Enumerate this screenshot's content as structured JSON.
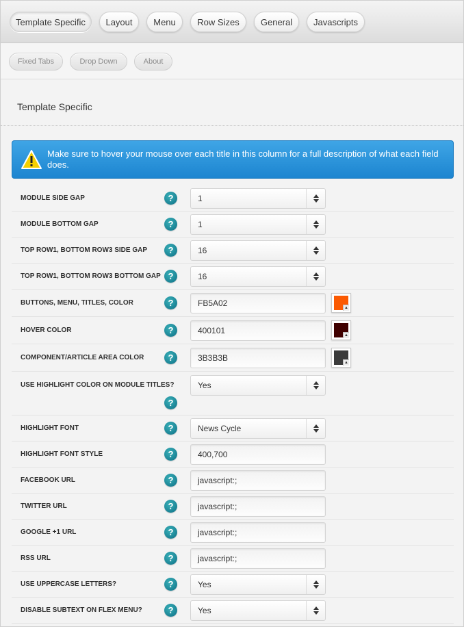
{
  "tabs": [
    {
      "label": "Template Specific"
    },
    {
      "label": "Layout"
    },
    {
      "label": "Menu"
    },
    {
      "label": "Row Sizes"
    },
    {
      "label": "General"
    },
    {
      "label": "Javascripts"
    }
  ],
  "subtabs": [
    {
      "label": "Fixed Tabs"
    },
    {
      "label": "Drop Down"
    },
    {
      "label": "About"
    }
  ],
  "section": {
    "title": "Template Specific"
  },
  "alert": {
    "icon": "warning-icon",
    "text": "Make sure to hover your mouse over each title in this column for a full description of what each field does."
  },
  "help_glyph": "?",
  "fields": [
    {
      "label": "MODULE SIDE GAP",
      "type": "select",
      "value": "1"
    },
    {
      "label": "MODULE BOTTOM GAP",
      "type": "select",
      "value": "1"
    },
    {
      "label": "TOP ROW1, BOTTOM ROW3 SIDE GAP",
      "type": "select",
      "value": "16"
    },
    {
      "label": "TOP ROW1, BOTTOM ROW3 BOTTOM GAP",
      "type": "select",
      "value": "16"
    },
    {
      "label": "BUTTONS, MENU, TITLES, COLOR",
      "type": "color",
      "value": "FB5A02",
      "swatch": "#FB5A02"
    },
    {
      "label": "HOVER COLOR",
      "type": "color",
      "value": "400101",
      "swatch": "#400101"
    },
    {
      "label": "COMPONENT/ARTICLE AREA COLOR",
      "type": "color",
      "value": "3B3B3B",
      "swatch": "#3B3B3B"
    },
    {
      "label": "USE HIGHLIGHT COLOR ON MODULE TITLES?",
      "type": "select",
      "value": "Yes"
    },
    {
      "label": "HIGHLIGHT FONT",
      "type": "select",
      "value": "News Cycle"
    },
    {
      "label": "HIGHLIGHT FONT STYLE",
      "type": "input",
      "value": "400,700"
    },
    {
      "label": "FACEBOOK URL",
      "type": "input",
      "value": "javascript:;"
    },
    {
      "label": "TWITTER URL",
      "type": "input",
      "value": "javascript:;"
    },
    {
      "label": "GOOGLE +1 URL",
      "type": "input",
      "value": "javascript:;"
    },
    {
      "label": "RSS URL",
      "type": "input",
      "value": "javascript:;"
    },
    {
      "label": "USE UPPERCASE LETTERS?",
      "type": "select",
      "value": "Yes"
    },
    {
      "label": "DISABLE SUBTEXT ON FLEX MENU?",
      "type": "select",
      "value": "Yes"
    }
  ]
}
